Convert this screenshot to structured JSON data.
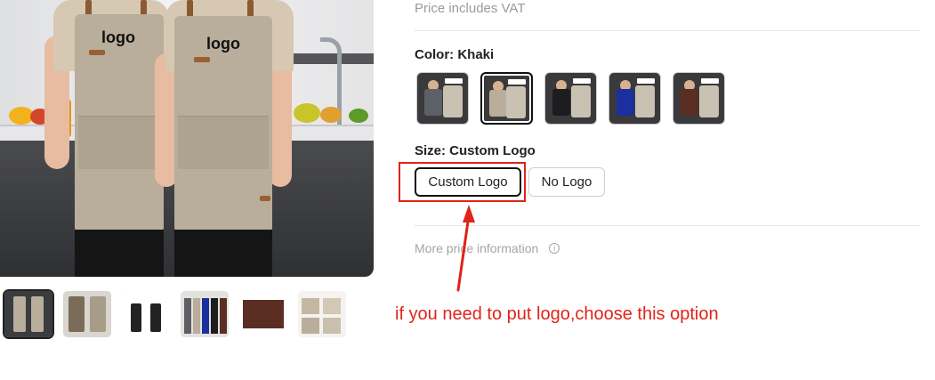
{
  "product": {
    "image_logo_left": "logo",
    "image_logo_right": "logo",
    "price_note": "Price includes VAT"
  },
  "color": {
    "label": "Color: Khaki",
    "options": [
      {
        "name": "grey",
        "apron": "#5d6066"
      },
      {
        "name": "khaki",
        "apron": "#b8ae9b"
      },
      {
        "name": "black",
        "apron": "#1d1d1f"
      },
      {
        "name": "blue",
        "apron": "#1c2f9e"
      },
      {
        "name": "coffee",
        "apron": "#5a2e22"
      }
    ],
    "selected_index": 1
  },
  "size": {
    "label": "Size: Custom Logo",
    "options": [
      "Custom Logo",
      "No Logo"
    ],
    "selected_index": 0
  },
  "more_info": "More price information",
  "annotation": "if you need to put logo,choose this option",
  "colors": {
    "annotation_red": "#e0231a",
    "selected_border": "#111111",
    "muted_text": "#9a9a9a"
  }
}
